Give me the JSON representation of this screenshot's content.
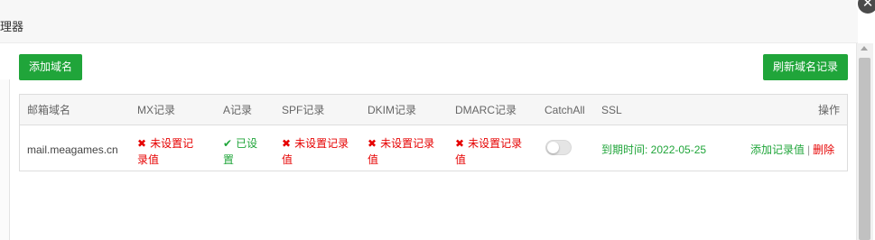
{
  "window": {
    "title": "理器",
    "close_icon": "✕"
  },
  "toolbar": {
    "add_domain_label": "添加域名",
    "refresh_label": "刷新域名记录"
  },
  "table": {
    "headers": {
      "domain": "邮箱域名",
      "mx": "MX记录",
      "a": "A记录",
      "spf": "SPF记录",
      "dkim": "DKIM记录",
      "dmarc": "DMARC记录",
      "catchall": "CatchAll",
      "ssl": "SSL",
      "actions": "操作"
    },
    "rows": [
      {
        "domain": "mail.meagames.cn",
        "mx": {
          "line1": "未设置记",
          "line2": "录值",
          "status": "error"
        },
        "a": {
          "line1": "已设",
          "line2": "置",
          "status": "ok"
        },
        "spf": {
          "line1": "未设置记录",
          "line2": "值",
          "status": "error"
        },
        "dkim": {
          "line1": "未设置记录",
          "line2": "值",
          "status": "error"
        },
        "dmarc": {
          "line1": "未设置记录",
          "line2": "值",
          "status": "error"
        },
        "catchall_enabled": false,
        "ssl": "到期时间: 2022-05-25",
        "action_add_record": "添加记录值",
        "action_separator": "|",
        "action_delete": "删除"
      }
    ]
  },
  "colors": {
    "accent": "#20a53a",
    "error": "#e60000",
    "header_bg": "#f6f6f6"
  },
  "icons": {
    "error": "✖",
    "ok": "✔"
  }
}
